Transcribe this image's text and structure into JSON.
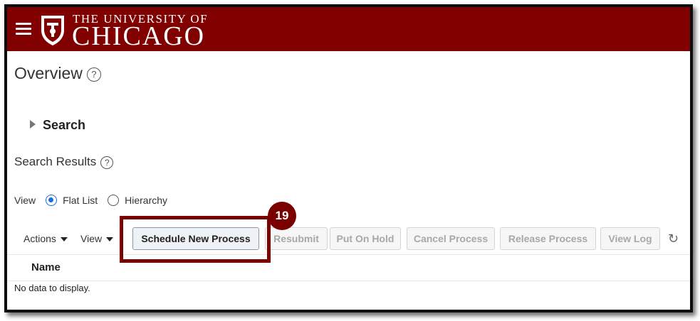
{
  "header": {
    "logo_top": "THE UNIVERSITY OF",
    "logo_main": "CHICAGO",
    "brand_color": "#800000"
  },
  "page": {
    "title": "Overview",
    "help_glyph": "?"
  },
  "search": {
    "label": "Search"
  },
  "results": {
    "title": "Search Results",
    "view_label": "View",
    "options": [
      "Flat List",
      "Hierarchy"
    ],
    "selected": "Flat List"
  },
  "toolbar": {
    "actions_label": "Actions",
    "view_label": "View",
    "buttons": [
      "Schedule New Process",
      "Resubmit",
      "Put On Hold",
      "Cancel Process",
      "Release Process",
      "View Log"
    ],
    "refresh_glyph": "↻"
  },
  "table": {
    "columns": [
      "Name"
    ],
    "empty_text": "No data to display."
  },
  "callout": {
    "number": "19",
    "color": "#7a0000"
  }
}
